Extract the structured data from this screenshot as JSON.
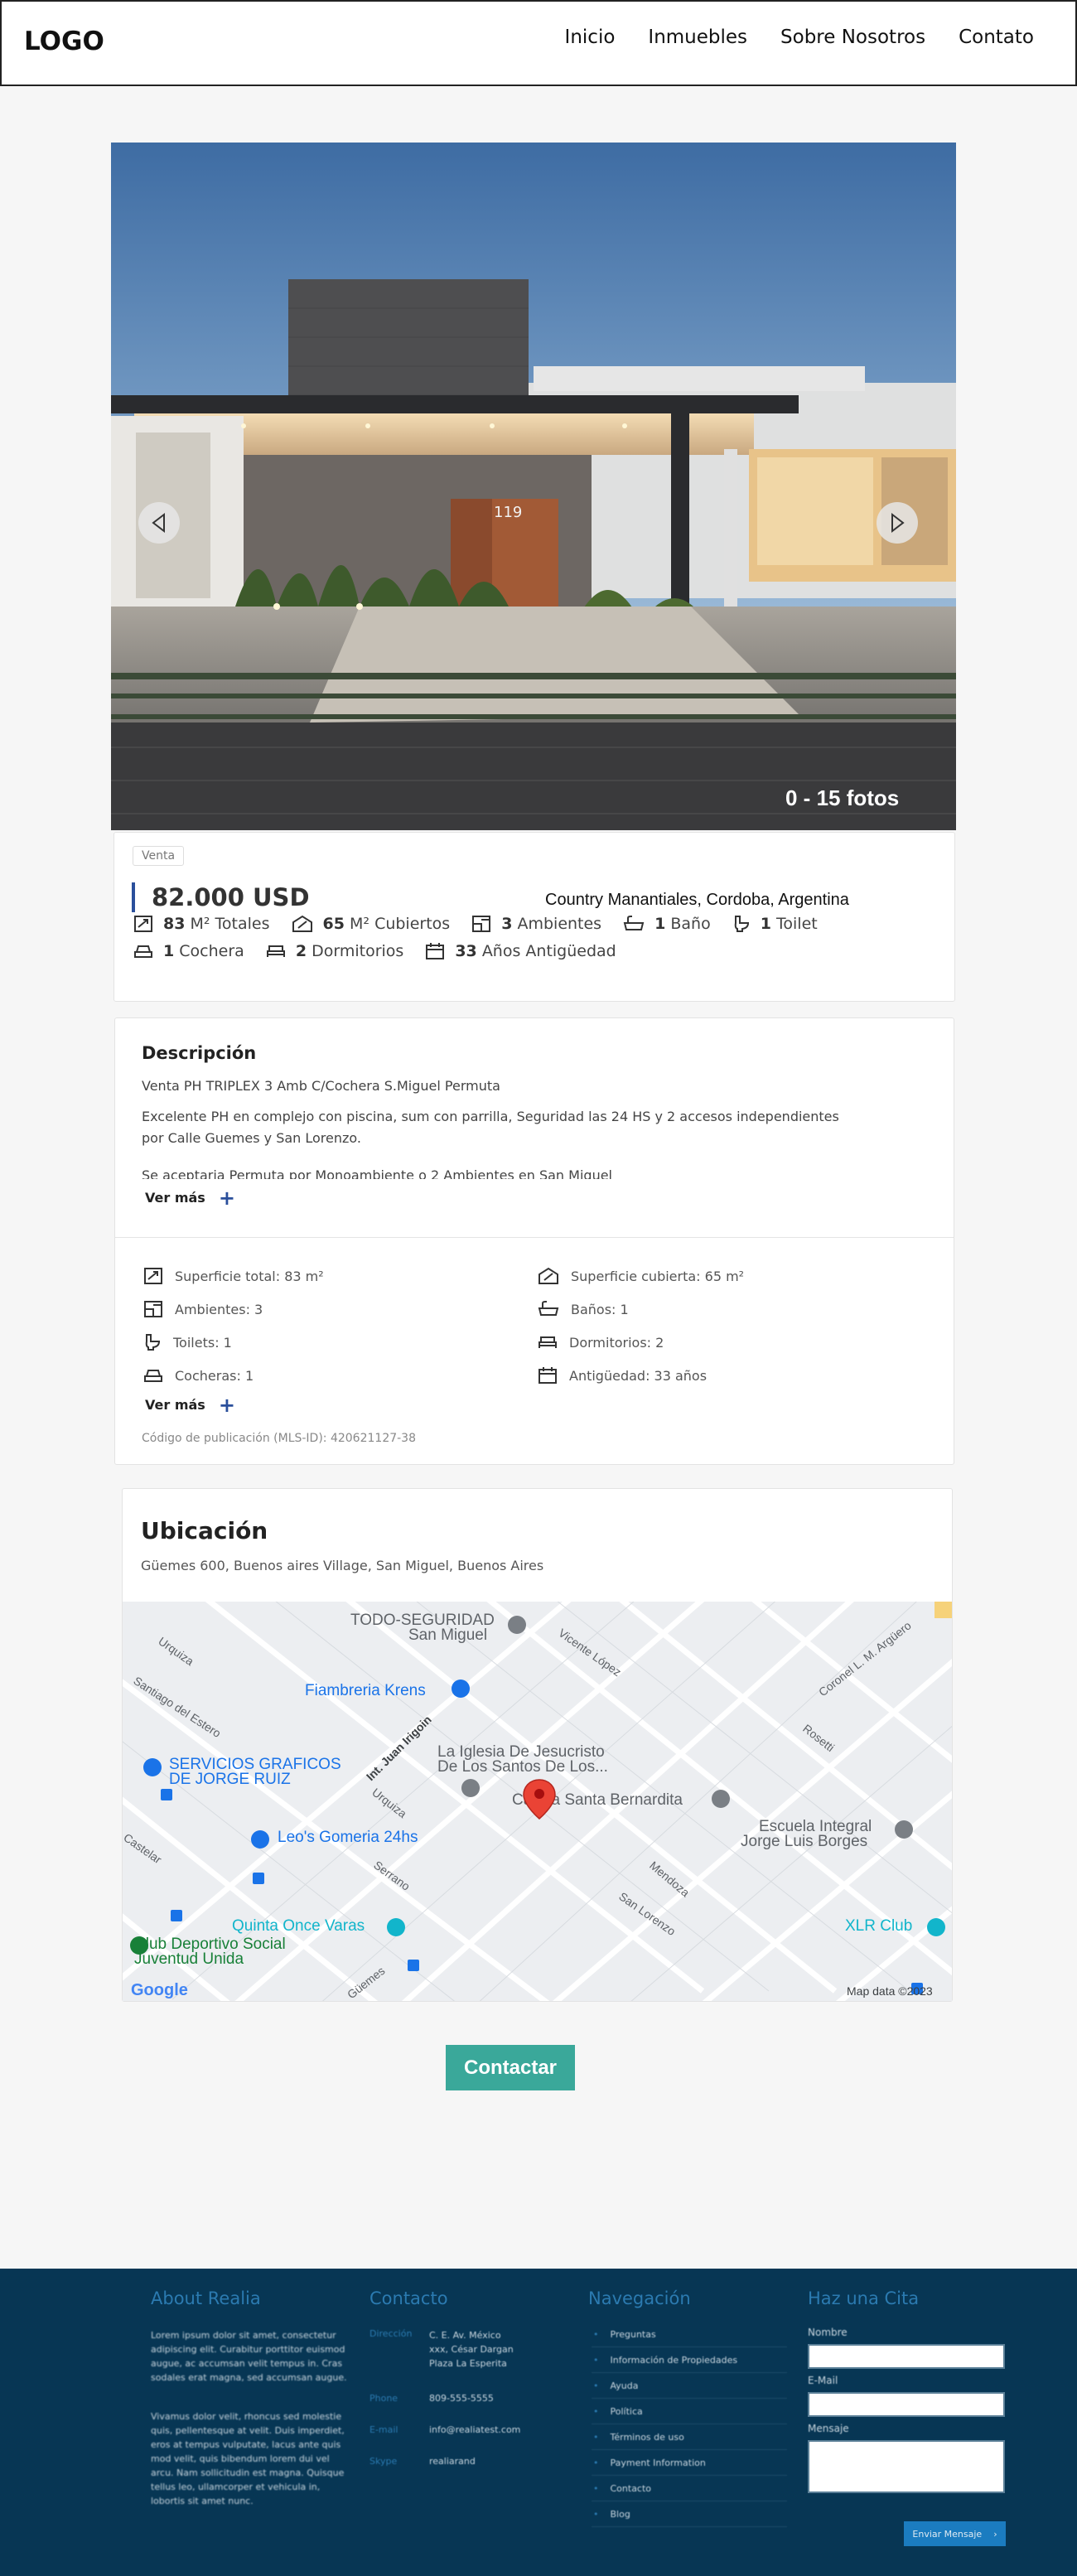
{
  "header": {
    "logo": "LOGO",
    "nav": [
      "Inicio",
      "Inmuebles",
      "Sobre Nosotros",
      "Contato"
    ]
  },
  "hero": {
    "house_number": "119",
    "photo_count": "0 - 15 fotos"
  },
  "summary": {
    "badge": "Venta",
    "price": "82.000 USD",
    "location": "Country Manantiales, Cordoba, Argentina",
    "features": [
      {
        "icon": "area-icon",
        "value": "83",
        "label": "M² Totales"
      },
      {
        "icon": "covered-area-icon",
        "value": "65",
        "label": "M² Cubiertos"
      },
      {
        "icon": "rooms-icon",
        "value": "3",
        "label": "Ambientes"
      },
      {
        "icon": "bath-icon",
        "value": "1",
        "label": "Baño"
      },
      {
        "icon": "toilet-icon",
        "value": "1",
        "label": "Toilet"
      },
      {
        "icon": "garage-icon",
        "value": "1",
        "label": "Cochera"
      },
      {
        "icon": "bed-icon",
        "value": "2",
        "label": "Dormitorios"
      },
      {
        "icon": "calendar-icon",
        "value": "33",
        "label": "Años Antigüedad"
      }
    ]
  },
  "description": {
    "title": "Descripción",
    "line1": "Venta PH TRIPLEX 3 Amb C/Cochera S.Miguel Permuta",
    "line2": "Excelente PH en complejo con piscina, sum con parrilla, Seguridad las 24 HS y 2 accesos independientes por Calle Guemes y San Lorenzo.",
    "line3": "Se aceptaria Permuta por Monoambiente o 2 Ambientes en San Miguel",
    "ver_mas": "Ver más",
    "specs": [
      {
        "icon": "area-icon",
        "text": "Superficie total: 83 m²"
      },
      {
        "icon": "covered-area-icon",
        "text": "Superficie cubierta: 65 m²"
      },
      {
        "icon": "rooms-icon",
        "text": "Ambientes: 3"
      },
      {
        "icon": "bath-icon",
        "text": "Baños: 1"
      },
      {
        "icon": "toilet-icon",
        "text": "Toilets: 1"
      },
      {
        "icon": "bed-icon",
        "text": "Dormitorios: 2"
      },
      {
        "icon": "garage-icon",
        "text": "Cocheras: 1"
      },
      {
        "icon": "calendar-icon",
        "text": "Antigüedad: 33 años"
      }
    ],
    "mls": "Código de publicación (MLS-ID): 420621127-38"
  },
  "location": {
    "title": "Ubicación",
    "address": "Güemes 600, Buenos aires Village, San Miguel, Buenos Aires",
    "map": {
      "places": [
        {
          "name": "TODO-SEGURIDAD",
          "name2": "San Miguel",
          "color": "#5f6368"
        },
        {
          "name": "Fiambreria Krens",
          "color": "#1a73e8"
        },
        {
          "name": "SERVICIOS GRAFICOS",
          "name2": "DE JORGE RUIZ",
          "color": "#1a73e8"
        },
        {
          "name": "La Iglesia De Jesucristo",
          "name2": "De Los Santos De Los...",
          "color": "#5f6368"
        },
        {
          "name": "Capilla Santa Bernardita",
          "color": "#5f6368"
        },
        {
          "name": "Escuela Integral",
          "name2": "Jorge Luis Borges",
          "color": "#5f6368"
        },
        {
          "name": "Leo's Gomeria 24hs",
          "color": "#1a73e8"
        },
        {
          "name": "Quinta Once Varas",
          "color": "#12b5cb"
        },
        {
          "name": "Club Deportivo Social",
          "name2": "Juventud Unida",
          "color": "#188038"
        },
        {
          "name": "XLR Club",
          "color": "#12b5cb"
        }
      ],
      "streets": [
        "Urquiza",
        "Vicente López",
        "Coronel L. M. Argüero",
        "Santiago del Estero",
        "Rosetti",
        "Int. Juan Irigoin",
        "Urquiza",
        "Castelar",
        "Serrano",
        "Mendoza",
        "San Lorenzo",
        "Güemes"
      ],
      "google": "Google",
      "attribution": "Map data ©2023"
    }
  },
  "contact_button": "Contactar",
  "footer": {
    "about_title": "About Realia",
    "about_p1": "Lorem ipsum dolor sit amet, consectetur adipiscing elit. Curabitur porttitor euismod augue, ac accumsan velit tempus in. Cras sodales erat magna, sed accumsan augue.",
    "about_p2": "Vivamus dolor velit, rhoncus sed molestie quis, pellentesque at velit. Duis imperdiet, eros at tempus vulputate, lacus ante quis mod velit, quis bibendum lorem dui vel arcu. Nam sollicitudin est magna. Quisque tellus leo, ullamcorper et vehicula in, lobortis sit amet nunc.",
    "contact_title": "Contacto",
    "direccion_label": "Dirección",
    "direccion": "C. E. Av. México",
    "direccion2": "xxx, César Dargan",
    "direccion3": "Plaza La Esperita",
    "phone_label": "Phone",
    "phone": "809-555-5555",
    "email_label": "E-mail",
    "email": "info@realiatest.com",
    "skype_label": "Skype",
    "skype": "realiarand",
    "nav_title": "Navegación",
    "nav_items": [
      "Preguntas",
      "Información de Propiedades",
      "Ayuda",
      "Política",
      "Términos de uso",
      "Payment Information",
      "Contacto",
      "Blog"
    ],
    "form_title": "Haz una Cita",
    "form_name": "Nombre",
    "form_email": "E-Mail",
    "form_message": "Mensaje",
    "form_button": "Enviar Mensaje"
  }
}
